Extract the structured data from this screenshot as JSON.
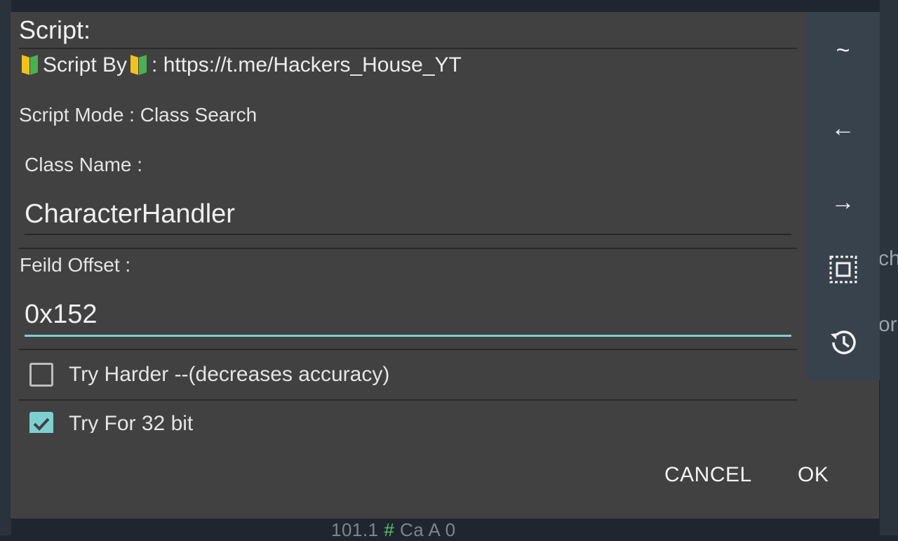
{
  "background": {
    "bottom_status_prefix": "101.1",
    "bottom_status_hash": "#",
    "bottom_status_suffix": "Ca A 0",
    "right_text": [
      "ch",
      "or"
    ]
  },
  "dialog": {
    "title": "Script:",
    "author_label": "Script By",
    "author_sep": ": ",
    "author_link": "https://t.me/Hackers_House_YT",
    "mode_text": "Script Mode : Class Search",
    "class_name_label": "Class Name :",
    "class_name_value": "CharacterHandler",
    "field_offset_label": "Feild Offset :",
    "field_offset_value": "0x152",
    "checkboxes": [
      {
        "label": "Try Harder --(decreases accuracy)",
        "checked": false
      },
      {
        "label": "Try For 32 bit",
        "checked": true
      }
    ],
    "cancel_label": "CANCEL",
    "ok_label": "OK"
  },
  "toolbar": {
    "tilde": "~",
    "left_arrow": "←",
    "right_arrow": "→"
  },
  "colors": {
    "dialog_bg": "#414141",
    "toolbar_bg": "#38424c",
    "accent": "#7ecfd0",
    "text": "#e4e4e4"
  }
}
